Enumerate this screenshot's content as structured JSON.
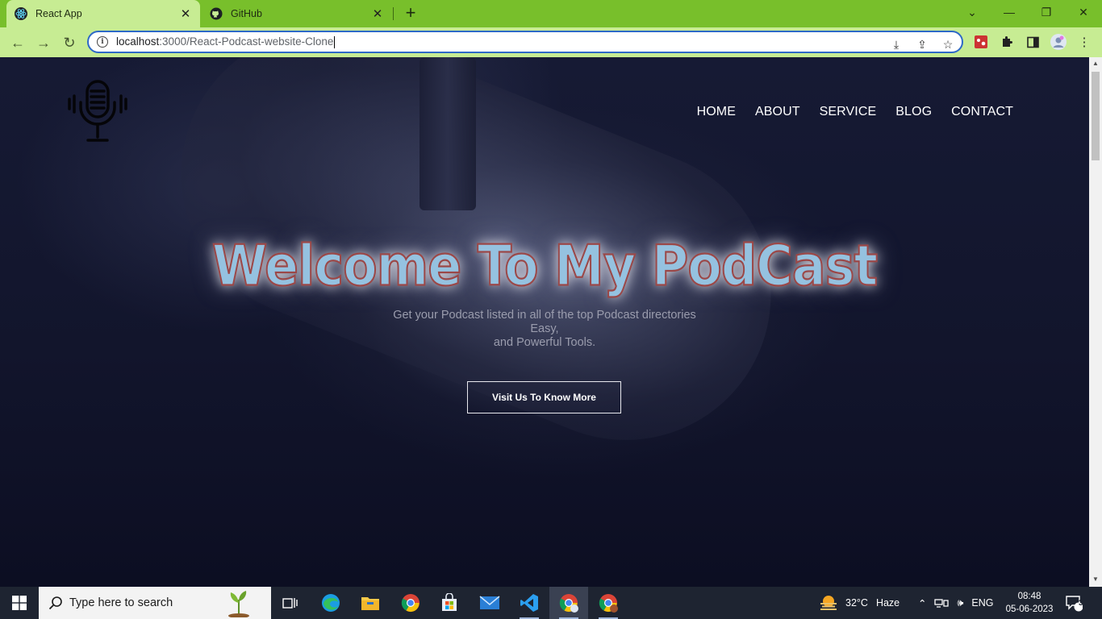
{
  "browser": {
    "tabs": [
      {
        "title": "React App",
        "active": true,
        "icon": "react-icon"
      },
      {
        "title": "GitHub",
        "active": false,
        "icon": "github-icon"
      }
    ],
    "url_host": "localhost",
    "url_path": ":3000/React-Podcast-website-Clone",
    "accent": "#78bf2b"
  },
  "site": {
    "nav": [
      "HOME",
      "ABOUT",
      "SERVICE",
      "BLOG",
      "CONTACT"
    ],
    "hero": {
      "title": "Welcome To My PodCast",
      "subtitle_line1": "Get your Podcast listed in all of the top Podcast directories",
      "subtitle_line2": "Easy,",
      "subtitle_line3": "and Powerful Tools.",
      "button": "Visit Us To Know More"
    }
  },
  "taskbar": {
    "search_placeholder": "Type here to search",
    "weather_temp": "32°C",
    "weather_desc": "Haze",
    "language": "ENG",
    "time": "08:48",
    "date": "05-06-2023",
    "notification_count": "3"
  }
}
